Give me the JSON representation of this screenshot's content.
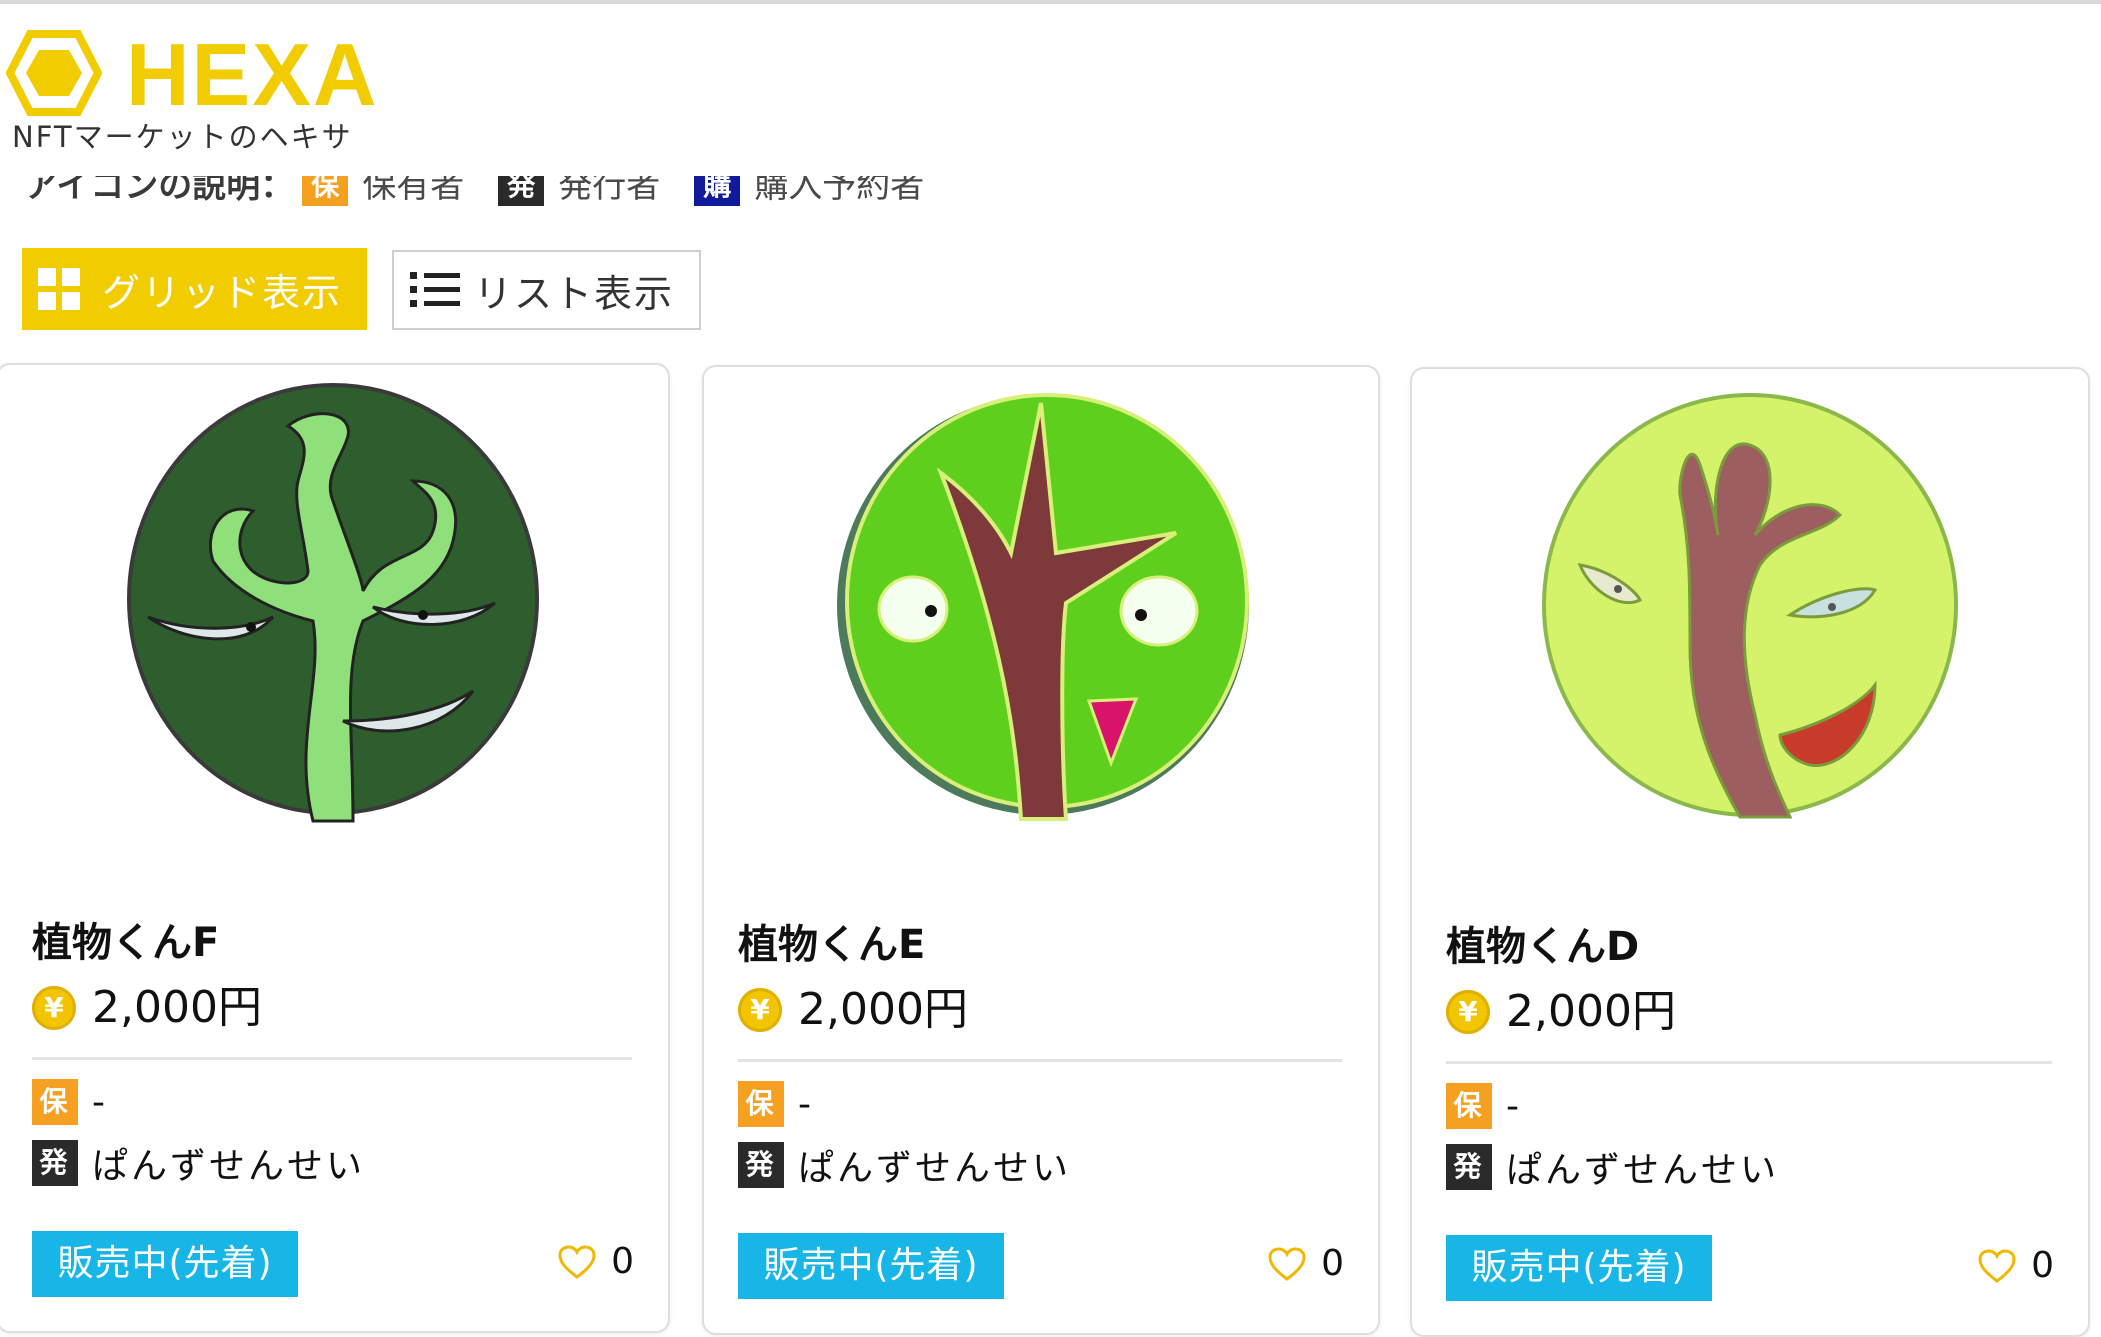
{
  "brand": {
    "name": "HEXA",
    "tagline": "NFTマーケットのヘキサ",
    "color": "#f1cc00"
  },
  "legend": {
    "label": "アイコンの説明：",
    "items": [
      {
        "chip": "保",
        "label": "保有者",
        "color": "#f5a020"
      },
      {
        "chip": "発",
        "label": "発行者",
        "color": "#2a2a2a"
      },
      {
        "chip": "購",
        "label": "購入予約者",
        "color": "#121a9c"
      }
    ]
  },
  "view_toggle": {
    "grid_label": "グリッド表示",
    "list_label": "リスト表示",
    "active": "grid"
  },
  "currency_symbol": "¥",
  "cards": [
    {
      "title": "植物くんF",
      "price": "2,000円",
      "owner_chip": "保",
      "owner": "-",
      "issuer_chip": "発",
      "issuer": "ぱんずせんせい",
      "status": "販売中(先着)",
      "likes": "0",
      "image": "dark-green-plant-character"
    },
    {
      "title": "植物くんE",
      "price": "2,000円",
      "owner_chip": "保",
      "owner": "-",
      "issuer_chip": "発",
      "issuer": "ぱんずせんせい",
      "status": "販売中(先着)",
      "likes": "0",
      "image": "green-tree-character"
    },
    {
      "title": "植物くんD",
      "price": "2,000円",
      "owner_chip": "保",
      "owner": "-",
      "issuer_chip": "発",
      "issuer": "ぱんずせんせい",
      "status": "販売中(先着)",
      "likes": "0",
      "image": "lime-sprout-character"
    }
  ],
  "colors": {
    "status_button": "#18b6e6",
    "coin": "#f3c400"
  }
}
